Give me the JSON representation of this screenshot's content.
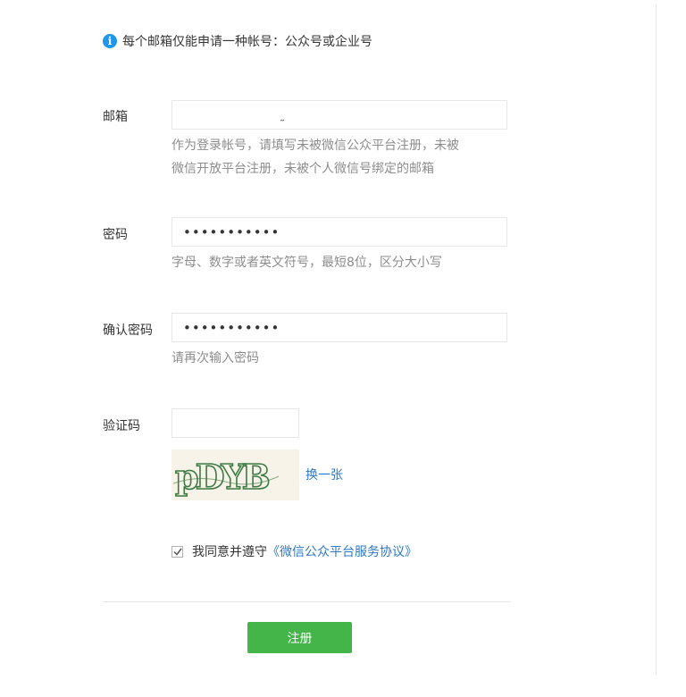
{
  "notice": {
    "icon": "info-icon",
    "text": "每个邮箱仅能申请一种帐号：公众号或企业号"
  },
  "form": {
    "email": {
      "label": "邮箱",
      "value": "˷",
      "tip_line1": "作为登录帐号，请填写未被微信公众平台注册，未被",
      "tip_line2": "微信开放平台注册，未被个人微信号绑定的邮箱"
    },
    "password": {
      "label": "密码",
      "value": "•••••••••••",
      "tip": "字母、数字或者英文符号，最短8位，区分大小写"
    },
    "confirm_password": {
      "label": "确认密码",
      "value": "•••••••••••",
      "tip": "请再次输入密码"
    },
    "captcha": {
      "label": "验证码",
      "value": "",
      "image_text": "pDYB",
      "swap_label": "换一张"
    },
    "agreement": {
      "checked": true,
      "prefix": "我同意并遵守",
      "link_text": "《微信公众平台服务协议》"
    },
    "submit_label": "注册"
  },
  "colors": {
    "accent_green": "#44b549",
    "link_blue": "#2e78c8",
    "info_blue": "#1e96eb",
    "tip_gray": "#8d8d8d",
    "border": "#e7e7eb"
  }
}
